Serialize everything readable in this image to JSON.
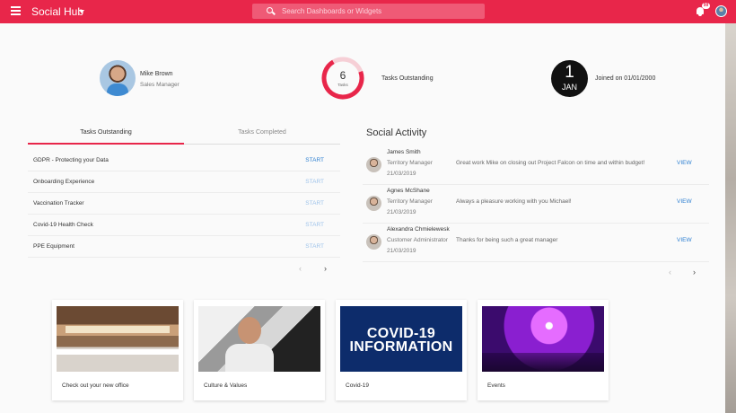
{
  "header": {
    "app_title": "Social Hub",
    "search_placeholder": "Search Dashboards or Widgets",
    "notification_count": "99"
  },
  "profile": {
    "name": "Mike Brown",
    "role": "Sales Manager"
  },
  "tasks_summary": {
    "count": "6",
    "ring_label": "Tasks",
    "caption": "Tasks Outstanding"
  },
  "joined": {
    "day": "1",
    "month": "JAN",
    "text": "Joined on 01/01/2000"
  },
  "tabs": {
    "outstanding": "Tasks Outstanding",
    "completed": "Tasks Completed"
  },
  "tasks": [
    {
      "name": "GDPR - Protecting your Data",
      "action": "START"
    },
    {
      "name": "Onboarding Experience",
      "action": "START"
    },
    {
      "name": "Vaccination Tracker",
      "action": "START"
    },
    {
      "name": "Covid-19 Health Check",
      "action": "START"
    },
    {
      "name": "PPE Equipment",
      "action": "START"
    }
  ],
  "social": {
    "title": "Social Activity",
    "items": [
      {
        "name": "James Smith",
        "role": "Territory Manager",
        "date": "21/03/2019",
        "message": "Great work Mike on closing out Project Falcon on time and within budget!",
        "action": "VIEW"
      },
      {
        "name": "Agnes McShane",
        "role": "Territory Manager",
        "date": "21/03/2019",
        "message": "Always a pleasure working with you Michael!",
        "action": "VIEW"
      },
      {
        "name": "Alexandra Chmielewesk",
        "role": "Customer Administrator",
        "date": "21/03/2019",
        "message": "Thanks for being such a great manager",
        "action": "VIEW"
      }
    ]
  },
  "cards": [
    {
      "label": "Check out your new office"
    },
    {
      "label": "Culture & Values"
    },
    {
      "label": "Covid-19",
      "image_text": "COVID-19 INFORMATION"
    },
    {
      "label": "Events"
    }
  ],
  "colors": {
    "accent": "#e8264a",
    "link": "#2f80d1"
  }
}
